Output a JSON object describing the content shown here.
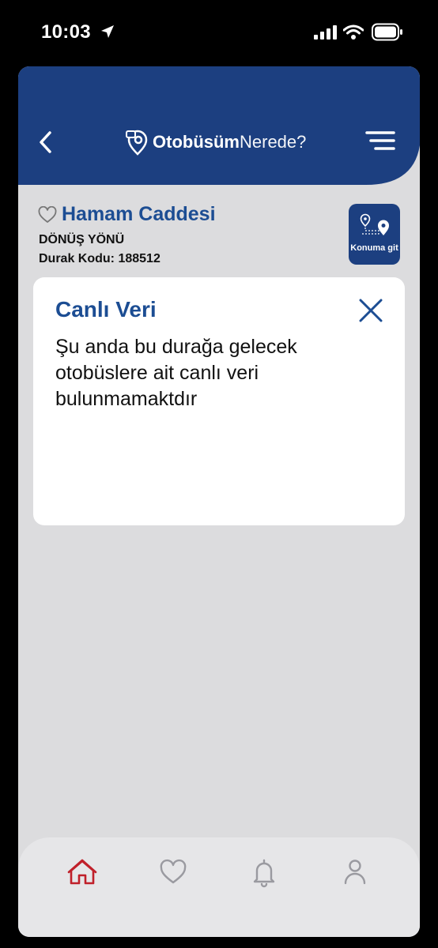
{
  "status_bar": {
    "time": "10:03",
    "icons": [
      "location-arrow-icon",
      "cellular-signal-icon",
      "wifi-icon",
      "battery-icon"
    ]
  },
  "header": {
    "logo_bold": "Otobüsüm",
    "logo_light": "Nerede?",
    "background_color": "#1c3f80",
    "icons": [
      "back-chevron-icon",
      "hamburger-menu-icon"
    ]
  },
  "stop": {
    "name": "Hamam Caddesi",
    "direction": "DÖNÜŞ YÖNÜ",
    "code": "Durak Kodu: 188512",
    "favorite_icon": "heart-outline-icon"
  },
  "goto_button": {
    "label": "Konuma git",
    "icon": "route-pin-icon"
  },
  "live_card": {
    "title": "Canlı Veri",
    "message": "Şu anda bu durağa gelecek otobüslere ait canlı veri bulunmamaktdır",
    "close_icon": "close-x-icon"
  },
  "bottom_nav": {
    "items": [
      {
        "icon": "home-icon",
        "active": true
      },
      {
        "icon": "heart-icon",
        "active": false
      },
      {
        "icon": "bell-icon",
        "active": false
      },
      {
        "icon": "user-icon",
        "active": false
      }
    ],
    "active_color": "#c0202a",
    "inactive_color": "#9a9aa0"
  },
  "colors": {
    "accent": "#1c4d93",
    "screen_background": "#dcdcde"
  }
}
